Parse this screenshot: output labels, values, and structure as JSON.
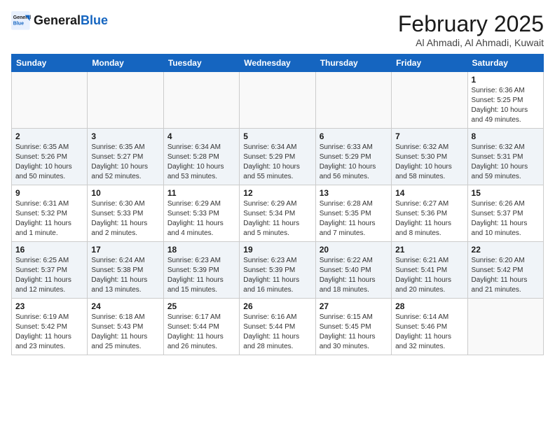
{
  "header": {
    "logo_line1": "General",
    "logo_line2": "Blue",
    "month": "February 2025",
    "location": "Al Ahmadi, Al Ahmadi, Kuwait"
  },
  "days_of_week": [
    "Sunday",
    "Monday",
    "Tuesday",
    "Wednesday",
    "Thursday",
    "Friday",
    "Saturday"
  ],
  "weeks": [
    [
      {
        "day": "",
        "info": ""
      },
      {
        "day": "",
        "info": ""
      },
      {
        "day": "",
        "info": ""
      },
      {
        "day": "",
        "info": ""
      },
      {
        "day": "",
        "info": ""
      },
      {
        "day": "",
        "info": ""
      },
      {
        "day": "1",
        "info": "Sunrise: 6:36 AM\nSunset: 5:25 PM\nDaylight: 10 hours and 49 minutes."
      }
    ],
    [
      {
        "day": "2",
        "info": "Sunrise: 6:35 AM\nSunset: 5:26 PM\nDaylight: 10 hours and 50 minutes."
      },
      {
        "day": "3",
        "info": "Sunrise: 6:35 AM\nSunset: 5:27 PM\nDaylight: 10 hours and 52 minutes."
      },
      {
        "day": "4",
        "info": "Sunrise: 6:34 AM\nSunset: 5:28 PM\nDaylight: 10 hours and 53 minutes."
      },
      {
        "day": "5",
        "info": "Sunrise: 6:34 AM\nSunset: 5:29 PM\nDaylight: 10 hours and 55 minutes."
      },
      {
        "day": "6",
        "info": "Sunrise: 6:33 AM\nSunset: 5:29 PM\nDaylight: 10 hours and 56 minutes."
      },
      {
        "day": "7",
        "info": "Sunrise: 6:32 AM\nSunset: 5:30 PM\nDaylight: 10 hours and 58 minutes."
      },
      {
        "day": "8",
        "info": "Sunrise: 6:32 AM\nSunset: 5:31 PM\nDaylight: 10 hours and 59 minutes."
      }
    ],
    [
      {
        "day": "9",
        "info": "Sunrise: 6:31 AM\nSunset: 5:32 PM\nDaylight: 11 hours and 1 minute."
      },
      {
        "day": "10",
        "info": "Sunrise: 6:30 AM\nSunset: 5:33 PM\nDaylight: 11 hours and 2 minutes."
      },
      {
        "day": "11",
        "info": "Sunrise: 6:29 AM\nSunset: 5:33 PM\nDaylight: 11 hours and 4 minutes."
      },
      {
        "day": "12",
        "info": "Sunrise: 6:29 AM\nSunset: 5:34 PM\nDaylight: 11 hours and 5 minutes."
      },
      {
        "day": "13",
        "info": "Sunrise: 6:28 AM\nSunset: 5:35 PM\nDaylight: 11 hours and 7 minutes."
      },
      {
        "day": "14",
        "info": "Sunrise: 6:27 AM\nSunset: 5:36 PM\nDaylight: 11 hours and 8 minutes."
      },
      {
        "day": "15",
        "info": "Sunrise: 6:26 AM\nSunset: 5:37 PM\nDaylight: 11 hours and 10 minutes."
      }
    ],
    [
      {
        "day": "16",
        "info": "Sunrise: 6:25 AM\nSunset: 5:37 PM\nDaylight: 11 hours and 12 minutes."
      },
      {
        "day": "17",
        "info": "Sunrise: 6:24 AM\nSunset: 5:38 PM\nDaylight: 11 hours and 13 minutes."
      },
      {
        "day": "18",
        "info": "Sunrise: 6:23 AM\nSunset: 5:39 PM\nDaylight: 11 hours and 15 minutes."
      },
      {
        "day": "19",
        "info": "Sunrise: 6:23 AM\nSunset: 5:39 PM\nDaylight: 11 hours and 16 minutes."
      },
      {
        "day": "20",
        "info": "Sunrise: 6:22 AM\nSunset: 5:40 PM\nDaylight: 11 hours and 18 minutes."
      },
      {
        "day": "21",
        "info": "Sunrise: 6:21 AM\nSunset: 5:41 PM\nDaylight: 11 hours and 20 minutes."
      },
      {
        "day": "22",
        "info": "Sunrise: 6:20 AM\nSunset: 5:42 PM\nDaylight: 11 hours and 21 minutes."
      }
    ],
    [
      {
        "day": "23",
        "info": "Sunrise: 6:19 AM\nSunset: 5:42 PM\nDaylight: 11 hours and 23 minutes."
      },
      {
        "day": "24",
        "info": "Sunrise: 6:18 AM\nSunset: 5:43 PM\nDaylight: 11 hours and 25 minutes."
      },
      {
        "day": "25",
        "info": "Sunrise: 6:17 AM\nSunset: 5:44 PM\nDaylight: 11 hours and 26 minutes."
      },
      {
        "day": "26",
        "info": "Sunrise: 6:16 AM\nSunset: 5:44 PM\nDaylight: 11 hours and 28 minutes."
      },
      {
        "day": "27",
        "info": "Sunrise: 6:15 AM\nSunset: 5:45 PM\nDaylight: 11 hours and 30 minutes."
      },
      {
        "day": "28",
        "info": "Sunrise: 6:14 AM\nSunset: 5:46 PM\nDaylight: 11 hours and 32 minutes."
      },
      {
        "day": "",
        "info": ""
      }
    ]
  ]
}
